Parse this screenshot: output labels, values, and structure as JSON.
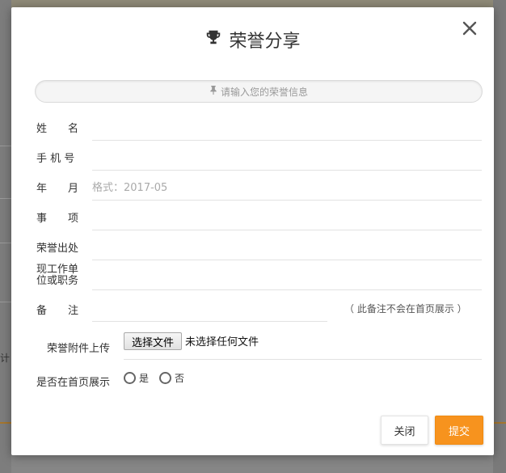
{
  "background": {
    "partial_text": "计"
  },
  "modal": {
    "title": "荣誉分享",
    "title_icon": "trophy-icon",
    "close_icon": "close-icon",
    "hint": {
      "icon": "pin-icon",
      "text": "请输入您的荣誉信息"
    },
    "fields": {
      "name": {
        "label": "姓　　名",
        "value": "",
        "placeholder": ""
      },
      "phone": {
        "label": "手 机 号",
        "value": "",
        "placeholder": ""
      },
      "date": {
        "label": "年　　月",
        "value": "",
        "placeholder": "格式：2017-05"
      },
      "event": {
        "label": "事　　项",
        "value": "",
        "placeholder": ""
      },
      "source": {
        "label": "荣誉出处",
        "value": "",
        "placeholder": ""
      },
      "position": {
        "label": "现工作单位或职务",
        "value": "",
        "placeholder": ""
      },
      "remark": {
        "label": "备　　注",
        "value": "",
        "placeholder": "",
        "note": "（ 此备注不会在首页展示 ）"
      }
    },
    "upload": {
      "label": "荣誉附件上传",
      "button": "选择文件",
      "status": "未选择任何文件"
    },
    "show_on_home": {
      "label": "是否在首页展示",
      "options": [
        "是",
        "否"
      ]
    },
    "buttons": {
      "close": "关闭",
      "submit": "提交"
    },
    "colors": {
      "accent": "#f7931e",
      "text": "#333333",
      "placeholder": "#aaaaaa",
      "divider": "#e2e2e2"
    }
  }
}
